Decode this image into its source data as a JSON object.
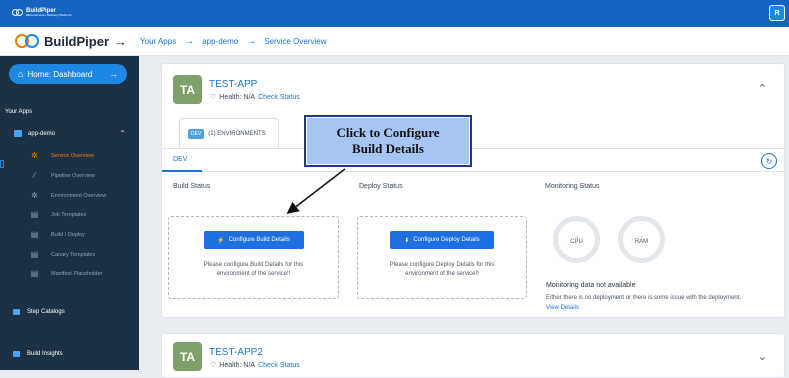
{
  "topbar": {
    "logo_text": "BuildPiper",
    "logo_subtitle": "Microservices Delivery Platform",
    "user_initial": "R"
  },
  "header": {
    "brand": "BuildPiper",
    "breadcrumbs": [
      "Your Apps",
      "app-demo",
      "Service Overview"
    ]
  },
  "sidebar": {
    "home_label": "Home: Dashboard",
    "section_title": "Your Apps",
    "app_name": "app-demo",
    "items": [
      {
        "label": "Service Overview",
        "icon": "gear-icon",
        "active": true
      },
      {
        "label": "Pipeline Overview",
        "icon": "magic-wand-icon",
        "active": false
      },
      {
        "label": "Environment Overview",
        "icon": "gear-icon",
        "active": false
      },
      {
        "label": "Job Templates",
        "icon": "document-icon",
        "active": false
      },
      {
        "label": "Build / Deploy",
        "icon": "document-icon",
        "active": false
      },
      {
        "label": "Canary Templates",
        "icon": "document-icon",
        "active": false
      },
      {
        "label": "Manifest Placeholder",
        "icon": "document-icon",
        "active": false
      }
    ],
    "step_catalogs": "Step Catalogs",
    "build_insights": "Build Insights"
  },
  "service1": {
    "initials": "TA",
    "name": "TEST-APP",
    "health_label": "Health: N/A",
    "check_status": "Check Status",
    "env_badge": "DEV",
    "env_count_label": "(1) ENVIRONMENTS",
    "dev_tab": "DEV",
    "build_status": "Build Status",
    "deploy_status": "Deploy Status",
    "monitoring_status": "Monitoring Status",
    "configure_build": "Configure Build Details",
    "configure_build_msg": "Please configure Build Details for this environment of the service!!",
    "configure_deploy": "Configure Deploy Details",
    "configure_deploy_msg": "Please configure Deploy Details for this environment of the service!!",
    "cpu_value": "...",
    "cpu_label": "CPU",
    "ram_value": "...",
    "ram_label": "RAM",
    "monitoring_na": "Monitoring data not available",
    "monitoring_msg": "Either there is no deployment or there is some issue with the deployment.",
    "view_details": "View Details"
  },
  "service2": {
    "initials": "TA",
    "name": "TEST-APP2",
    "health_label": "Health: N/A",
    "check_status": "Check Status"
  },
  "callout": {
    "line1": "Click to Configure",
    "line2": "Build Details"
  },
  "colors": {
    "topbar": "#1565c0",
    "sidebar": "#1d3144",
    "accent": "#1976d2",
    "active": "#f57c00",
    "callout_bg": "#a8c6f4"
  }
}
